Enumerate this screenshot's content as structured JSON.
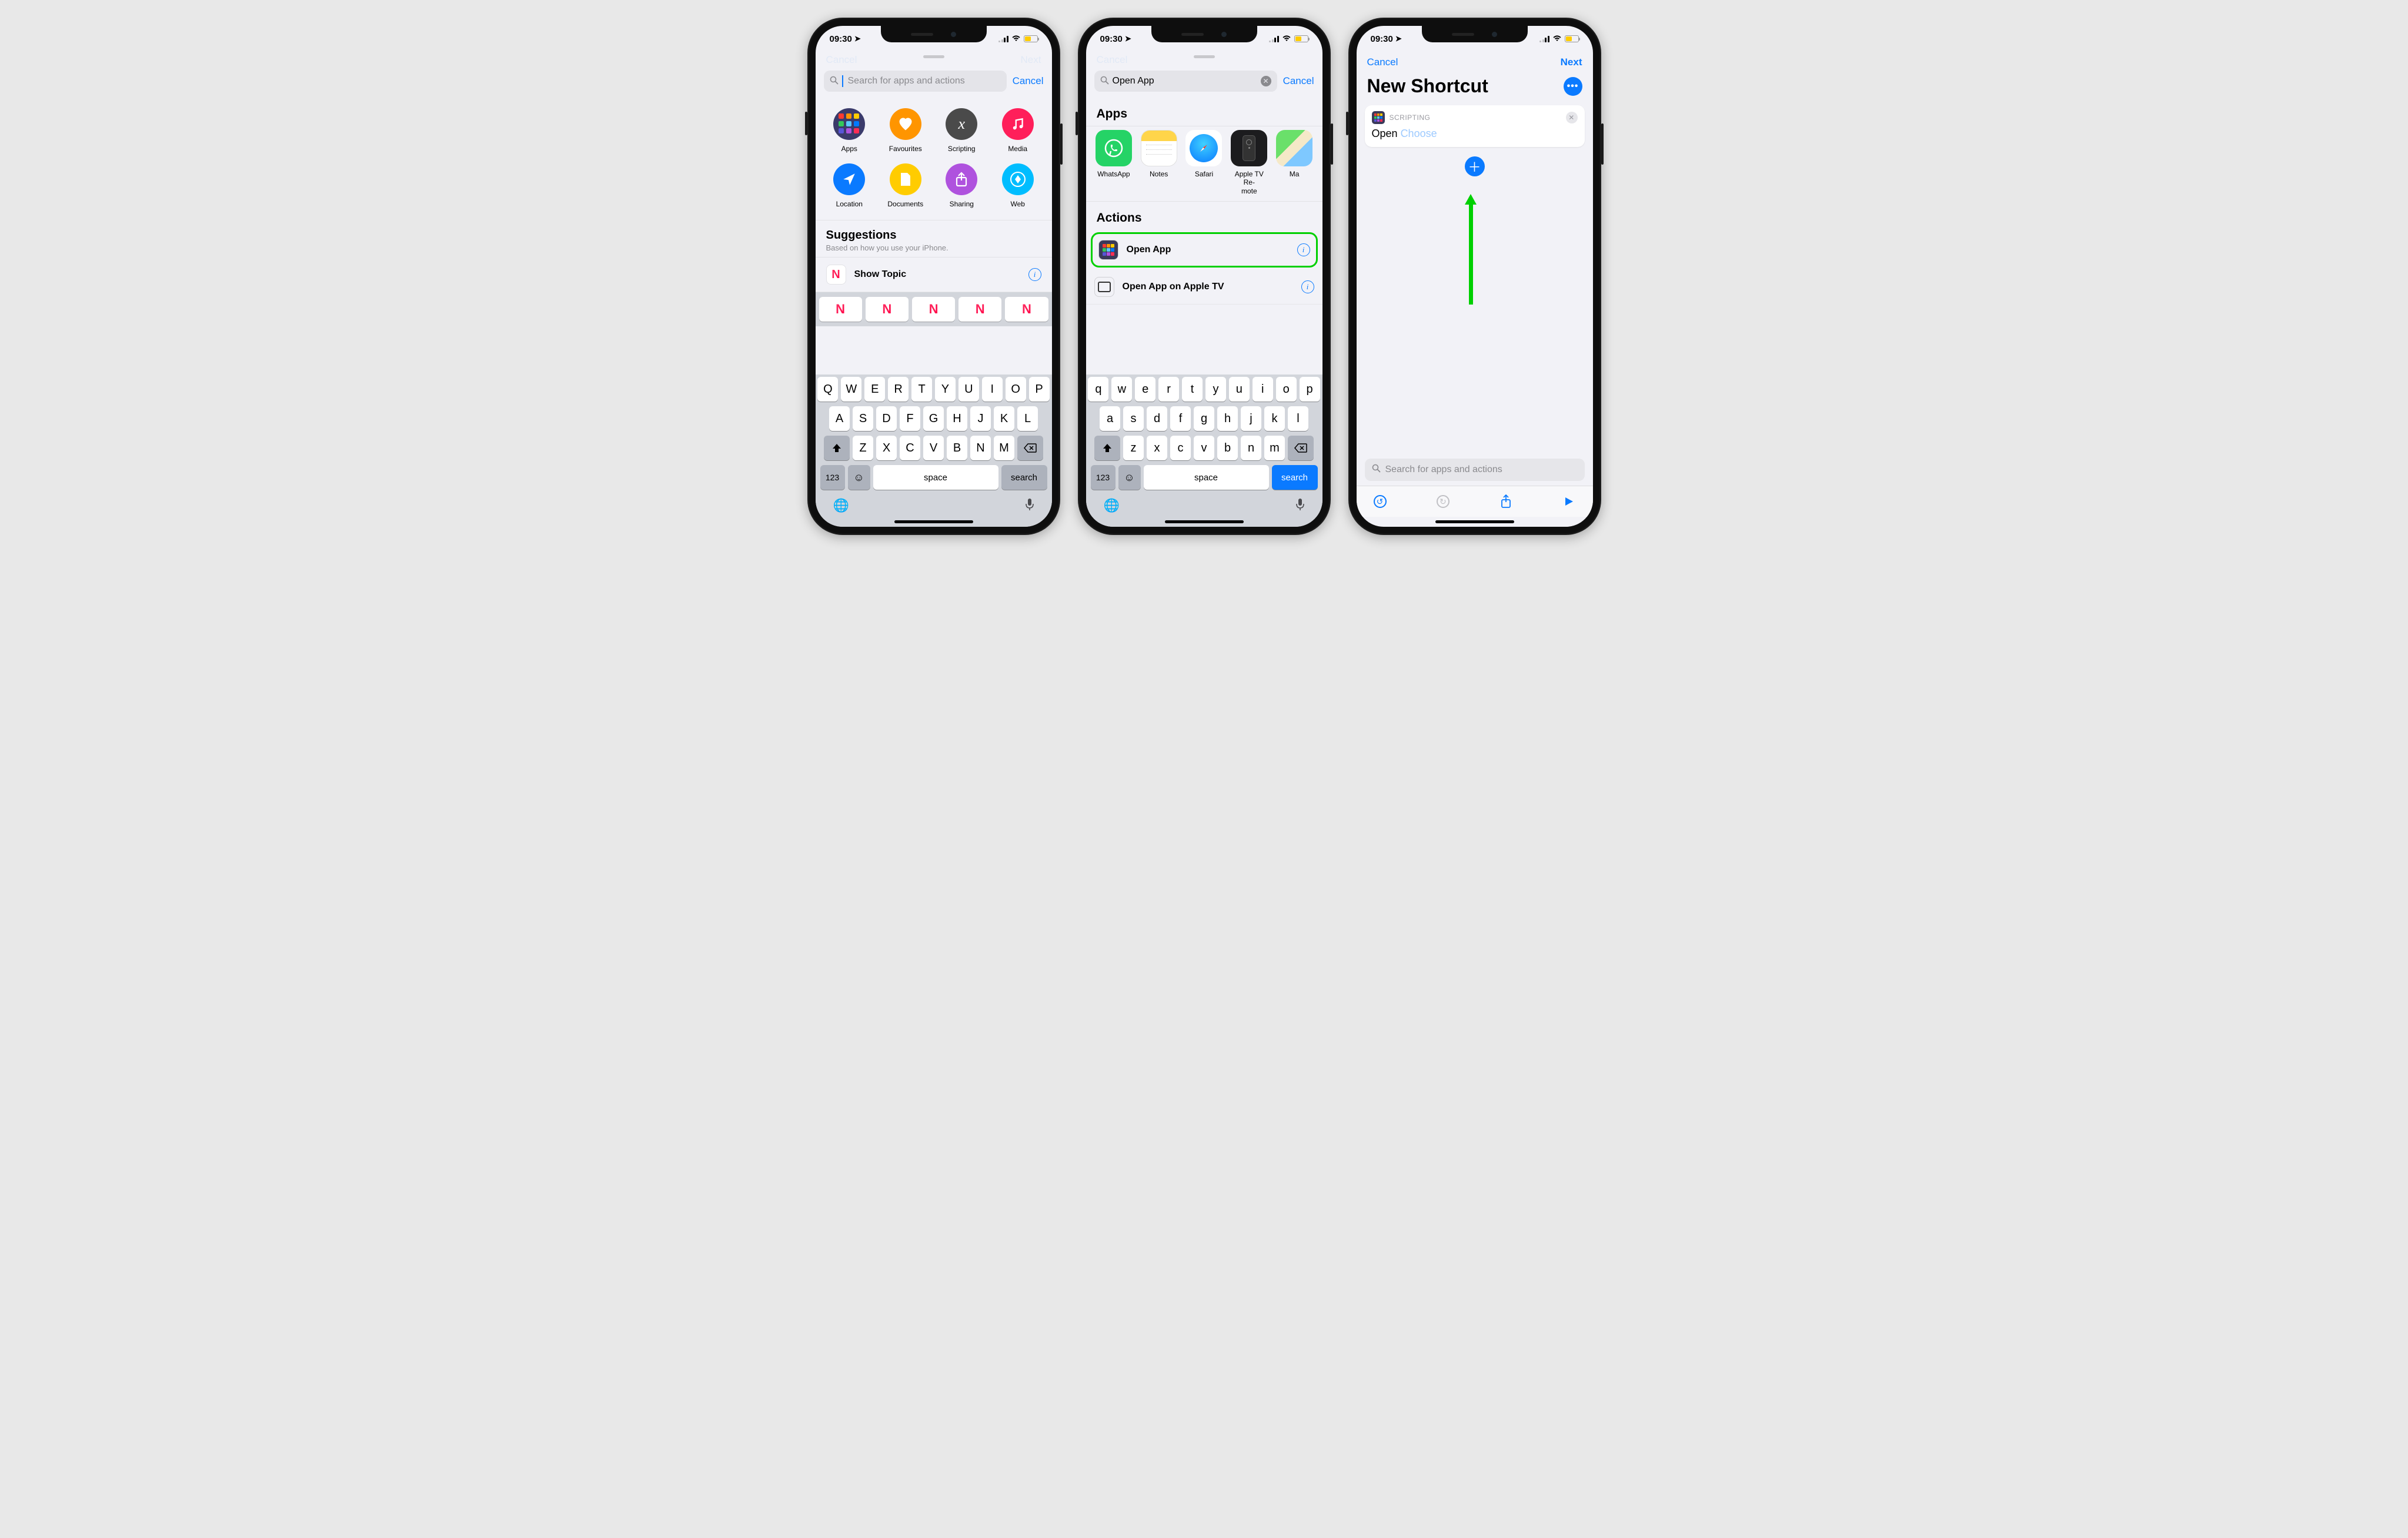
{
  "status": {
    "time": "09:30",
    "low_power": true
  },
  "screen1": {
    "nav_left": "Cancel",
    "nav_right": "Next",
    "search_placeholder": "Search for apps and actions",
    "cancel": "Cancel",
    "categories": [
      {
        "label": "Apps",
        "color": "#3b3b6b"
      },
      {
        "label": "Favourites",
        "color": "#ff9500"
      },
      {
        "label": "Scripting",
        "color": "#4a4a4a"
      },
      {
        "label": "Media",
        "color": "#ff1f5a"
      },
      {
        "label": "Location",
        "color": "#0a7aff"
      },
      {
        "label": "Documents",
        "color": "#ffcc00"
      },
      {
        "label": "Sharing",
        "color": "#af52de"
      },
      {
        "label": "Web",
        "color": "#00bdff"
      }
    ],
    "suggestions_title": "Suggestions",
    "suggestions_sub": "Based on how you use your iPhone.",
    "suggestion_item": "Show Topic",
    "keys_upper": [
      "Q",
      "W",
      "E",
      "R",
      "T",
      "Y",
      "U",
      "I",
      "O",
      "P",
      "A",
      "S",
      "D",
      "F",
      "G",
      "H",
      "J",
      "K",
      "L",
      "Z",
      "X",
      "C",
      "V",
      "B",
      "N",
      "M"
    ],
    "kb": {
      "num": "123",
      "space": "space",
      "search": "search"
    }
  },
  "screen2": {
    "search_value": "Open App",
    "cancel": "Cancel",
    "apps_title": "Apps",
    "apps": [
      {
        "label": "WhatsApp"
      },
      {
        "label": "Notes"
      },
      {
        "label": "Safari"
      },
      {
        "label": "Apple TV Re-\nmote"
      },
      {
        "label": "Ma"
      }
    ],
    "actions_title": "Actions",
    "actions": [
      {
        "label": "Open App",
        "highlight": true
      },
      {
        "label": "Open App on Apple TV",
        "highlight": false
      }
    ],
    "keys_lower": [
      "q",
      "w",
      "e",
      "r",
      "t",
      "y",
      "u",
      "i",
      "o",
      "p",
      "a",
      "s",
      "d",
      "f",
      "g",
      "h",
      "j",
      "k",
      "l",
      "z",
      "x",
      "c",
      "v",
      "b",
      "n",
      "m"
    ],
    "kb": {
      "num": "123",
      "space": "space",
      "search": "search"
    }
  },
  "screen3": {
    "cancel": "Cancel",
    "next": "Next",
    "title": "New Shortcut",
    "card_source": "SCRIPTING",
    "open": "Open",
    "choose": "Choose",
    "search_placeholder": "Search for apps and actions"
  }
}
